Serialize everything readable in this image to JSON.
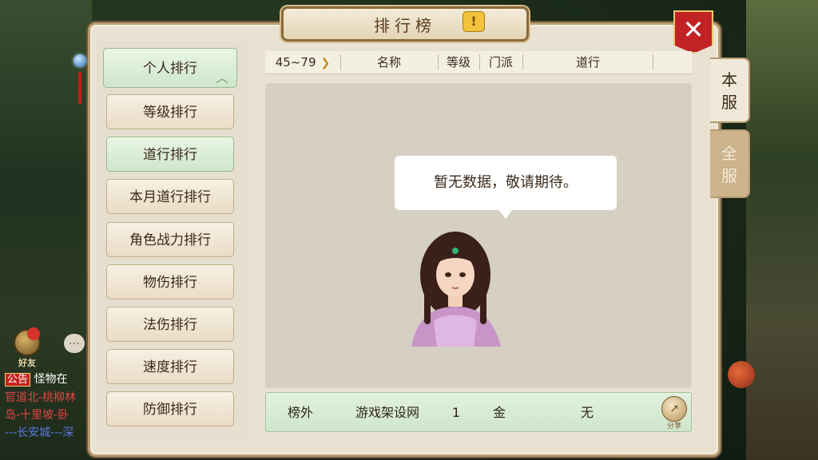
{
  "window": {
    "title": "排行榜",
    "help_icon": "!",
    "close_icon": "✕"
  },
  "sidebar": {
    "items": [
      {
        "label": "个人排行",
        "active": true,
        "expanded": true
      },
      {
        "label": "等级排行"
      },
      {
        "label": "道行排行",
        "active": true
      },
      {
        "label": "本月道行排行"
      },
      {
        "label": "角色战力排行"
      },
      {
        "label": "物伤排行"
      },
      {
        "label": "法伤排行"
      },
      {
        "label": "速度排行"
      },
      {
        "label": "防御排行"
      }
    ]
  },
  "filter": {
    "level_range": "45~79",
    "columns": [
      "名称",
      "等级",
      "门派",
      "道行"
    ]
  },
  "empty_state": {
    "message": "暂无数据，敬请期待。"
  },
  "self_row": {
    "rank": "榜外",
    "name": "游戏架设网",
    "level": "1",
    "sect": "金",
    "daoheng": "无",
    "share_label": "分享"
  },
  "server_tabs": [
    {
      "label": "本\n服",
      "active": true
    },
    {
      "label": "全\n服",
      "active": false
    }
  ],
  "chat": {
    "friend_label": "好友",
    "chat_icon": "…",
    "lines": [
      {
        "tag": "公告",
        "text": "怪物在"
      },
      {
        "text": "官道北-桃柳林"
      },
      {
        "text": "岛-十里坡-卧"
      },
      {
        "text": "---长安城---深"
      }
    ]
  },
  "colors": {
    "close_red": "#c12325",
    "active_green": "#cfe6cd",
    "panel": "#e9e2d3"
  }
}
